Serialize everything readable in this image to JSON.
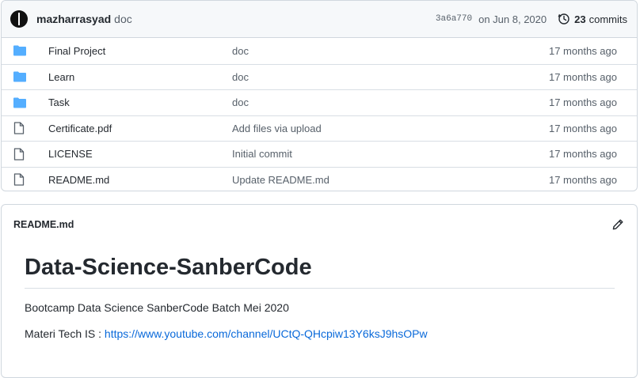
{
  "latest_commit": {
    "author": "mazharrasyad",
    "message": "doc",
    "sha": "3a6a770",
    "date": "on Jun 8, 2020",
    "commit_count": "23",
    "commits_label": "commits"
  },
  "files": [
    {
      "type": "folder",
      "name": "Final Project",
      "commit": "doc",
      "age": "17 months ago"
    },
    {
      "type": "folder",
      "name": "Learn",
      "commit": "doc",
      "age": "17 months ago"
    },
    {
      "type": "folder",
      "name": "Task",
      "commit": "doc",
      "age": "17 months ago"
    },
    {
      "type": "file",
      "name": "Certificate.pdf",
      "commit": "Add files via upload",
      "age": "17 months ago"
    },
    {
      "type": "file",
      "name": "LICENSE",
      "commit": "Initial commit",
      "age": "17 months ago"
    },
    {
      "type": "file",
      "name": "README.md",
      "commit": "Update README.md",
      "age": "17 months ago"
    }
  ],
  "readme": {
    "filename": "README.md",
    "heading": "Data-Science-SanberCode",
    "paragraph1": "Bootcamp Data Science SanberCode Batch Mei 2020",
    "materi_prefix": "Materi Tech IS : ",
    "materi_link": "https://www.youtube.com/channel/UCtQ-QHcpiw13Y6ksJ9hsOPw"
  },
  "colors": {
    "folder_icon": "#54aeff",
    "link": "#0969da",
    "muted_text": "#57606a",
    "border": "#d0d7de"
  },
  "icons": {
    "folder": "folder-icon",
    "file": "file-icon",
    "history": "history-icon",
    "edit": "pencil-icon"
  }
}
